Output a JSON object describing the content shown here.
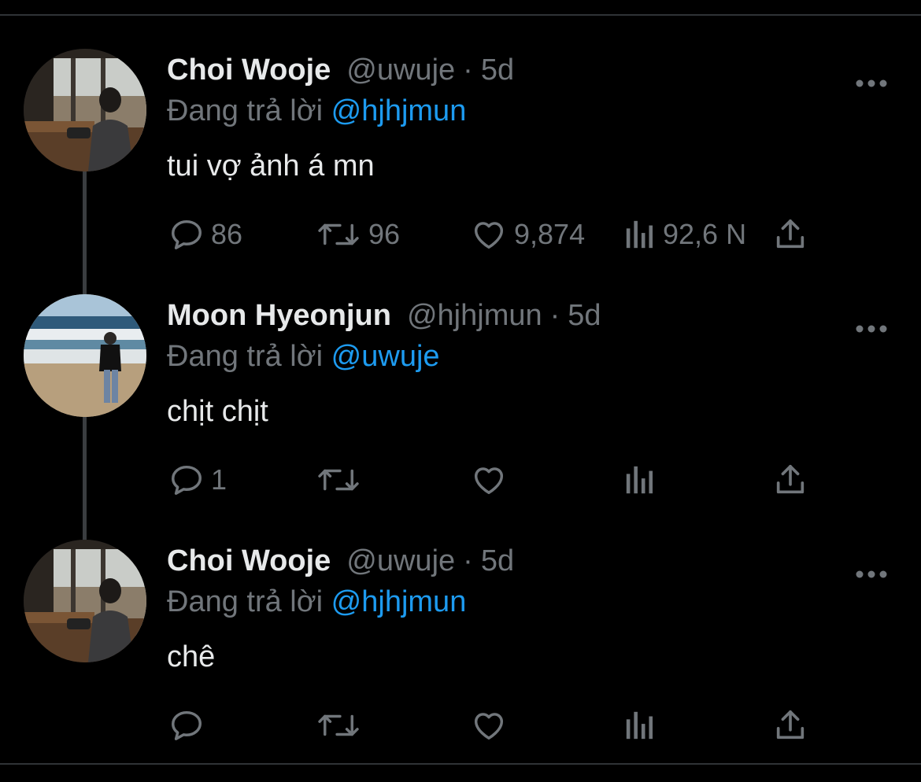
{
  "thread": {
    "tweets": [
      {
        "display_name": "Choi Wooje",
        "handle": "@uwuje",
        "separator": "·",
        "time": "5d",
        "reply_prefix": "Đang trả lời",
        "reply_mention": "@hjhjmun",
        "text": "tui vợ ảnh á mn",
        "stats": {
          "replies": "86",
          "retweets": "96",
          "likes": "9,874",
          "views": "92,6 N"
        },
        "avatar": "person-at-window-photo"
      },
      {
        "display_name": "Moon Hyeonjun",
        "handle": "@hjhjmun",
        "separator": "·",
        "time": "5d",
        "reply_prefix": "Đang trả lời",
        "reply_mention": "@uwuje",
        "text": "chịt chịt",
        "stats": {
          "replies": "1",
          "retweets": "",
          "likes": "",
          "views": ""
        },
        "avatar": "person-on-beach-photo"
      },
      {
        "display_name": "Choi Wooje",
        "handle": "@uwuje",
        "separator": "·",
        "time": "5d",
        "reply_prefix": "Đang trả lời",
        "reply_mention": "@hjhjmun",
        "text": "chê",
        "stats": {
          "replies": "",
          "retweets": "",
          "likes": "",
          "views": ""
        },
        "avatar": "person-at-window-photo"
      }
    ]
  },
  "colors": {
    "background": "#000000",
    "primary_text": "#e7e9ea",
    "secondary_text": "#71767b",
    "mention": "#1d9bf0",
    "thread_line": "#3a3d40"
  },
  "icons": [
    "reply-icon",
    "retweet-icon",
    "like-icon",
    "views-icon",
    "share-icon",
    "more-icon"
  ]
}
